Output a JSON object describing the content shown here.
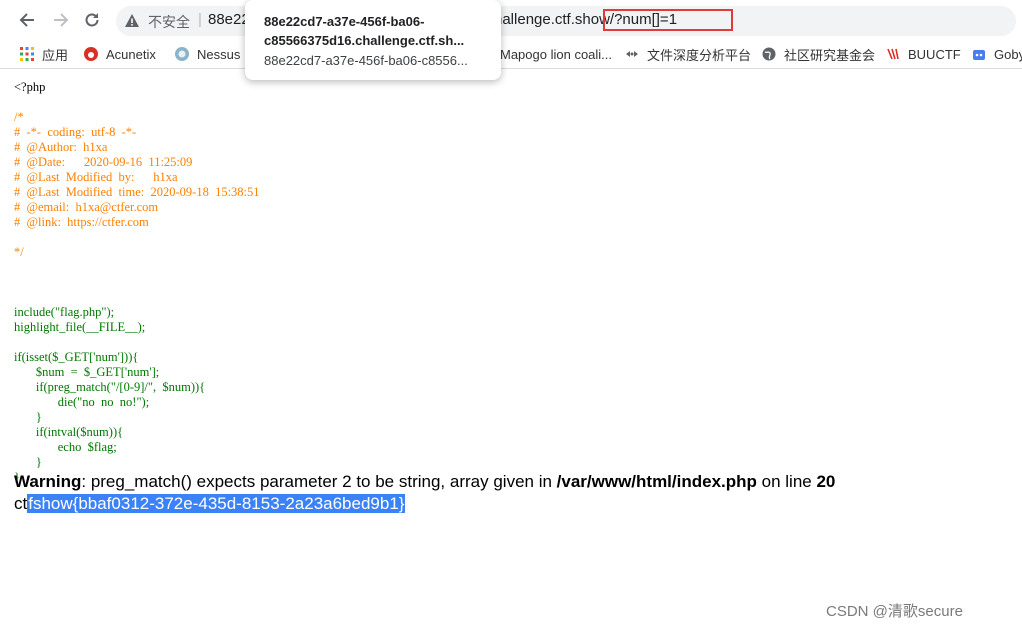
{
  "browser": {
    "insecure_label": "不安全",
    "url_host": "88e22",
    "url_tail": "hallenge.ctf.show/?num[]=1",
    "tooltip": {
      "line1": "88e22cd7-a37e-456f-ba06-",
      "line2": "c85566375d16.challenge.ctf.sh...",
      "line3": "88e22cd7-a37e-456f-ba06-c8556..."
    }
  },
  "bookmarks": [
    {
      "label": "应用",
      "icon": "apps-grid-icon"
    },
    {
      "label": "Acunetix",
      "icon": "acunetix-icon"
    },
    {
      "label": "Nessus E",
      "icon": "nessus-icon"
    },
    {
      "label": "Mapogo lion coali...",
      "icon": "bookmark-icon"
    },
    {
      "label": "文件深度分析平台",
      "icon": "file-analysis-icon"
    },
    {
      "label": "社区研究基金会",
      "icon": "globe-icon"
    },
    {
      "label": "BUUCTF",
      "icon": "buuctf-icon"
    },
    {
      "label": "Goby",
      "icon": "goby-icon"
    }
  ],
  "code": {
    "l1": "<?php",
    "l2": "/*",
    "l3": "#  -*-  coding:  utf-8  -*-",
    "l4": "#  @Author:  h1xa",
    "l5": "#  @Date:      2020-09-16  11:25:09",
    "l6": "#  @Last  Modified  by:      h1xa",
    "l7": "#  @Last  Modified  time:  2020-09-18  15:38:51",
    "l8": "#  @email:  h1xa@ctfer.com",
    "l9": "#  @link:  https://ctfer.com",
    "l10": "*/",
    "l11": "include(\"flag.php\");",
    "l12": "highlight_file(__FILE__);",
    "l13": "if(isset($_GET['num'])){",
    "l14": "       $num  =  $_GET['num'];",
    "l15": "       if(preg_match(\"/[0-9]/\",  $num)){",
    "l16": "              die(\"no  no  no!\");",
    "l17": "       }",
    "l18": "       if(intval($num)){",
    "l19": "              echo  $flag;",
    "l20": "       }",
    "l21": "}"
  },
  "warning": {
    "label": "Warning",
    "message": ": preg_match() expects parameter 2 to be string, array given in ",
    "path": "/var/www/html/index.php",
    "on_line": " on line ",
    "line_no": "20"
  },
  "flag": {
    "prefix": "ct",
    "selected": "fshow{bbaf0312-372e-435d-8153-2a23a6bed9b1}"
  },
  "watermark": "CSDN @清歌secure",
  "colors": {
    "php_keyword": "#007700",
    "php_comment": "#ff8000",
    "selection": "#3b82f6",
    "url_highlight_box": "#e03a3a"
  }
}
